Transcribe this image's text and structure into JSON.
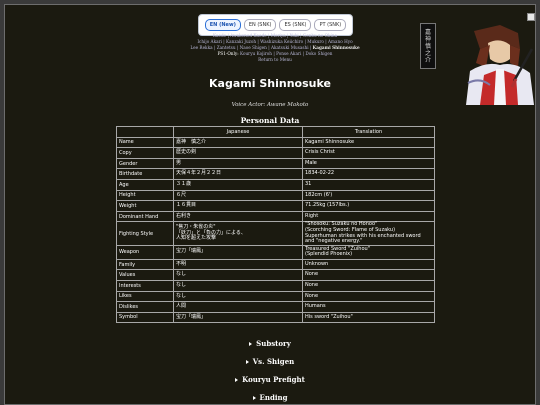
{
  "languages": [
    {
      "label": "EN (New)",
      "active": true
    },
    {
      "label": "EN (SNK)",
      "active": false
    },
    {
      "label": "ES (SNK)",
      "active": false
    },
    {
      "label": "PT (SNK)",
      "active": false
    }
  ],
  "nav": {
    "row1": [
      "Kaede",
      "Awakened Kaede",
      "Moriya",
      "Yuki",
      "Genbu no Okina"
    ],
    "row2": [
      "Ichijo Akari",
      "Kanzaki Juzoh",
      "Washizuka Keiichiro",
      "Mukuro",
      "Amano Hyo"
    ],
    "row3": [
      "Lee Rekka",
      "Zantetsu",
      "Naoe Shigen",
      "Akatsuki Musashi"
    ],
    "row3_current": "Kagami Shinnosuke",
    "psi_label": "PS1-Only:",
    "psi_items": [
      "Kouryu Kojiroh",
      "Ponse Akari",
      "Doko Shigen"
    ],
    "return": "Return to Menu"
  },
  "emblem_text": [
    "嘉",
    "神",
    "慎",
    "之",
    "介"
  ],
  "page_title": "Kagami Shinnosuke",
  "voice_actor": "Voice Actor: Awane Makoto",
  "personal_data_title": "Personal Data",
  "table": {
    "headers": [
      "Japanese",
      "Translation"
    ],
    "rows": [
      {
        "label": "Name",
        "jp": [
          "嘉神　慎之介"
        ],
        "tr": [
          "Kagami Shinnosuke"
        ]
      },
      {
        "label": "Copy",
        "jp": [
          "歴史の剣"
        ],
        "tr": [
          "Crisis Christ"
        ]
      },
      {
        "label": "Gender",
        "jp": [
          "男"
        ],
        "tr": [
          "Male"
        ]
      },
      {
        "label": "Birthdate",
        "jp": [
          "天保４年２月２２日"
        ],
        "tr": [
          "1834-02-22"
        ]
      },
      {
        "label": "Age",
        "jp": [
          "３１歳"
        ],
        "tr": [
          "31"
        ]
      },
      {
        "label": "Height",
        "jp": [
          "６尺"
        ],
        "tr": [
          "182cm (6')"
        ]
      },
      {
        "label": "Weight",
        "jp": [
          "１６貫目"
        ],
        "tr": [
          "71.25kg (157lbs.)"
        ]
      },
      {
        "label": "Dominant Hand",
        "jp": [
          "右利き"
        ],
        "tr": [
          "Right"
        ]
      },
      {
        "label": "Fighting Style",
        "jp": [
          "\"焦刀・朱雀の炎\"",
          "「妖刀」と「負の力」による、",
          "人知を超えた攻撃"
        ],
        "tr": [
          "\"Shosoku: Suzaku no Honoo\"",
          "(Scorching Sword: Flame of Suzaku)",
          "Superhuman strikes with his enchanted sword",
          "and \"negative energy.\""
        ]
      },
      {
        "label": "Weapon",
        "jp": [
          "宝刀「瑞鳳」"
        ],
        "tr": [
          "Treasured Sword \"Zuihou\"",
          "(Splendid Phoenix)"
        ]
      },
      {
        "label": "Family",
        "jp": [
          "不明"
        ],
        "tr": [
          "Unknown"
        ]
      },
      {
        "label": "Values",
        "jp": [
          "なし"
        ],
        "tr": [
          "None"
        ]
      },
      {
        "label": "Interests",
        "jp": [
          "なし"
        ],
        "tr": [
          "None"
        ]
      },
      {
        "label": "Likes",
        "jp": [
          "なし"
        ],
        "tr": [
          "None"
        ]
      },
      {
        "label": "Dislikes",
        "jp": [
          "人間"
        ],
        "tr": [
          "Humans"
        ]
      },
      {
        "label": "Symbol",
        "jp": [
          "宝刀「瑞鳳」"
        ],
        "tr": [
          "His sword \"Zuihou\""
        ]
      }
    ]
  },
  "stories": [
    "Substory",
    "Vs. Shigen",
    "Kouryu Prefight",
    "Ending"
  ],
  "colors": {
    "page_bg": "#1b1a10",
    "link": "#b8b8d8",
    "active_lang": "#2b6fd6"
  }
}
